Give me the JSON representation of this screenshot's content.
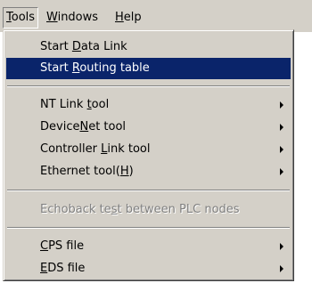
{
  "menubar": {
    "items": [
      {
        "accel": "T",
        "rest": "ools"
      },
      {
        "accel": "W",
        "rest": "indows"
      },
      {
        "accel": "H",
        "rest": "elp"
      }
    ]
  },
  "tools_menu": {
    "start_data_link": {
      "pre": "Start ",
      "accel": "D",
      "post": "ata Link"
    },
    "start_routing_table": {
      "pre": "Start ",
      "accel": "R",
      "post": "outing table"
    },
    "nt_link_tool": {
      "pre": "NT Link ",
      "accel": "t",
      "post": "ool"
    },
    "devicenet_tool": {
      "pre": "Device",
      "accel": "N",
      "post": "et tool"
    },
    "controller_link_tool": {
      "pre": "Controller ",
      "accel": "L",
      "post": "ink tool"
    },
    "ethernet_tool": {
      "pre": "Ethernet tool(",
      "accel": "H",
      "post": ")"
    },
    "echoback_test": {
      "pre": "Echoback te",
      "accel": "s",
      "post": "t between PLC nodes"
    },
    "cps_file": {
      "pre": "",
      "accel": "C",
      "post": "PS file"
    },
    "eds_file": {
      "pre": "",
      "accel": "E",
      "post": "DS file"
    }
  },
  "colors": {
    "menu_face": "#d4d0c8",
    "highlight": "#0a246a",
    "disabled_text": "#808080"
  }
}
